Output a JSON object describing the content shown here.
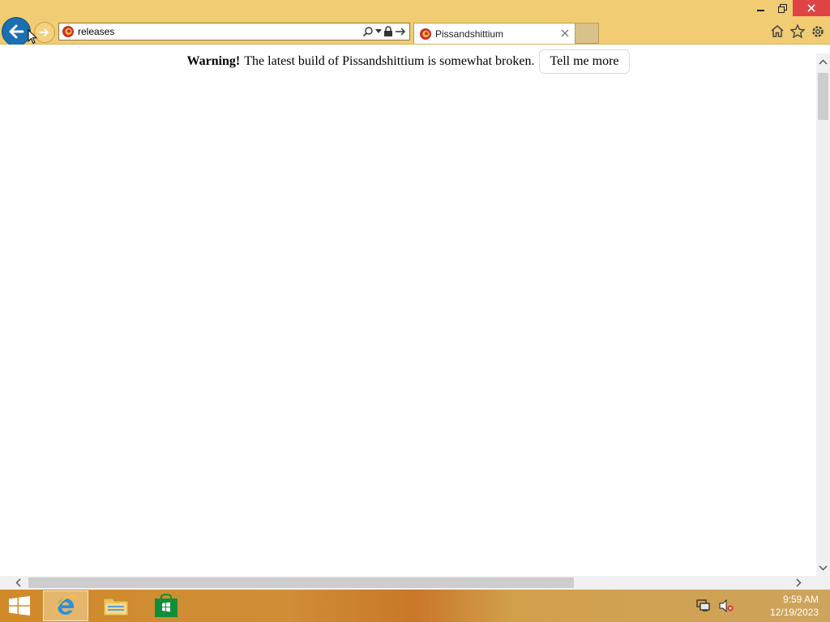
{
  "window": {
    "minimize_label": "–",
    "restore_label": "❐",
    "close_label": "✕"
  },
  "address_bar": {
    "value": "releases",
    "site_icon": "firefox-like-globe-icon"
  },
  "tab": {
    "title": "Pissandshittium"
  },
  "page": {
    "warning_strong": "Warning!",
    "warning_text": "The latest build of Pissandshittium is somewhat broken.",
    "tell_more_label": "Tell me more"
  },
  "taskbar": {
    "apps": [
      "Internet Explorer",
      "File Explorer",
      "Store"
    ],
    "time": "9:59 AM",
    "date": "12/19/2023"
  },
  "colors": {
    "chrome_bg": "#f1cc72",
    "back_button": "#1b6fb3",
    "close_button": "#e04343",
    "taskbar": "#d08a2a"
  }
}
